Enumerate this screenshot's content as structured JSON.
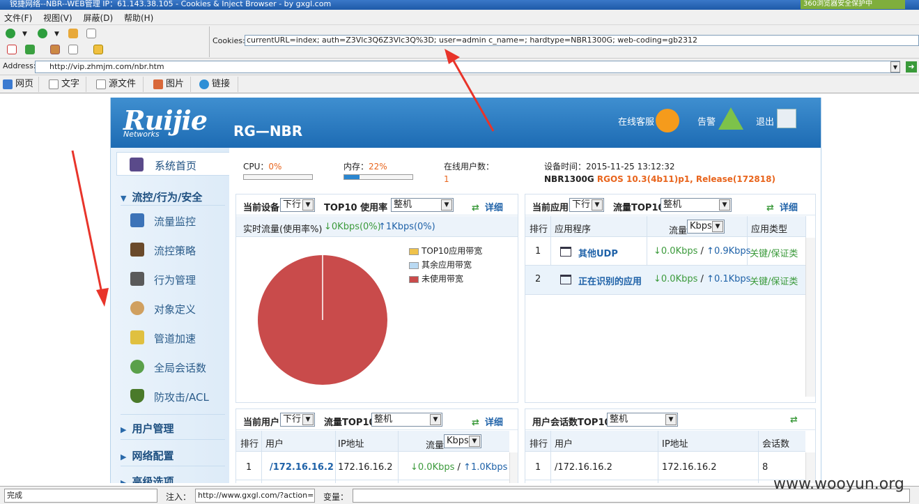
{
  "window": {
    "title": "锐捷网络--NBR--WEB管理 IP：61.143.38.105 - Cookies & Inject Browser - by gxgl.com",
    "right_badge": "360浏览器安全保护中"
  },
  "menu": [
    "文件(F)",
    "视图(V)",
    "屏蔽(D)",
    "帮助(H)"
  ],
  "cookies": {
    "label": "Cookies:",
    "value": "currentURL=index; auth=Z3Vlc3Q6Z3Vlc3Q%3D; user=admin c_name=; hardtype=NBR1300G; web-coding=gb2312"
  },
  "address": {
    "label": "Address:",
    "value": "http://vip.zhmjm.com/nbr.htm"
  },
  "tabs": [
    "网页",
    "文字",
    "源文件",
    "图片",
    "链接"
  ],
  "banner": {
    "logo": "Ruijie",
    "logo_sub": "Networks",
    "model": "RG—NBR",
    "online_service": "在线客服",
    "alarm": "告警",
    "logout": "退出"
  },
  "sidebar": {
    "home": "系统首页",
    "group1": "流控/行为/安全",
    "items": [
      "流量监控",
      "流控策略",
      "行为管理",
      "对象定义",
      "管道加速",
      "全局会话数",
      "防攻击/ACL"
    ],
    "group2": "用户管理",
    "group3": "网络配置",
    "group4": "高级选项"
  },
  "stats": {
    "cpu_label": "CPU：",
    "cpu_value": "0%",
    "cpu_level": 0,
    "mem_label": "内存：",
    "mem_value": "22%",
    "mem_level": 22,
    "online_label": "在线用户数：",
    "online_value": "1",
    "time_label": "设备时间：",
    "time_value": "2015-11-25 13:12:32",
    "device": "NBR1300G",
    "version": "RGOS 10.3(4b11)p1, Release(172818)"
  },
  "panel_device": {
    "cur": "当前设备",
    "dir": "下行",
    "top": "TOP10 使用率",
    "scope": "整机",
    "detail": "详细",
    "realtime": "实时流量(使用率%)",
    "down": "↓0Kbps(0%)",
    "up": "↑1Kbps(0%)",
    "legend": [
      "TOP10应用带宽",
      "其余应用带宽",
      "未使用带宽"
    ],
    "legend_colors": [
      "#efc24b",
      "#b9d9f2",
      "#c94b4b"
    ]
  },
  "chart_data": {
    "type": "pie",
    "categories": [
      "TOP10应用带宽",
      "其余应用带宽",
      "未使用带宽"
    ],
    "values": [
      0,
      0,
      100
    ],
    "colors": [
      "#efc24b",
      "#b9d9f2",
      "#c94b4b"
    ]
  },
  "panel_app": {
    "cur": "当前应用",
    "dir": "下行",
    "top": "流量TOP10",
    "scope": "整机",
    "detail": "详细",
    "headers": [
      "排行",
      "应用程序",
      "流量",
      "Kbps",
      "应用类型"
    ],
    "rows": [
      {
        "rank": "1",
        "app": "其他UDP",
        "down": "↓0.0Kbps",
        "sep": "/",
        "up": "↑0.9Kbps",
        "type": "关键/保证类"
      },
      {
        "rank": "2",
        "app": "正在识别的应用",
        "down": "↓0.0Kbps",
        "sep": "/",
        "up": "↑0.1Kbps",
        "type": "关键/保证类"
      }
    ]
  },
  "panel_user": {
    "cur": "当前用户",
    "dir": "下行",
    "top": "流量TOP10",
    "scope": "整机",
    "detail": "详细",
    "headers": [
      "排行",
      "用户",
      "IP地址",
      "流量",
      "Kbps"
    ],
    "rows": [
      {
        "rank": "1",
        "user": "/172.16.16.2",
        "ip": "172.16.16.2",
        "down": "↓0.0Kbps",
        "sep": "/",
        "up": "↑1.0Kbps"
      }
    ]
  },
  "panel_session": {
    "title": "用户会话数TOP10",
    "scope": "整机",
    "headers": [
      "排行",
      "用户",
      "IP地址",
      "会话数"
    ],
    "rows": [
      {
        "rank": "1",
        "user": "/172.16.16.2",
        "ip": "172.16.16.2",
        "count": "8"
      }
    ]
  },
  "status": {
    "done": "完成",
    "inject_label": "注入：",
    "inject_value": "http://www.gxgl.com/?action=show",
    "var_label": "变量："
  },
  "watermark": "www.wooyun.org"
}
